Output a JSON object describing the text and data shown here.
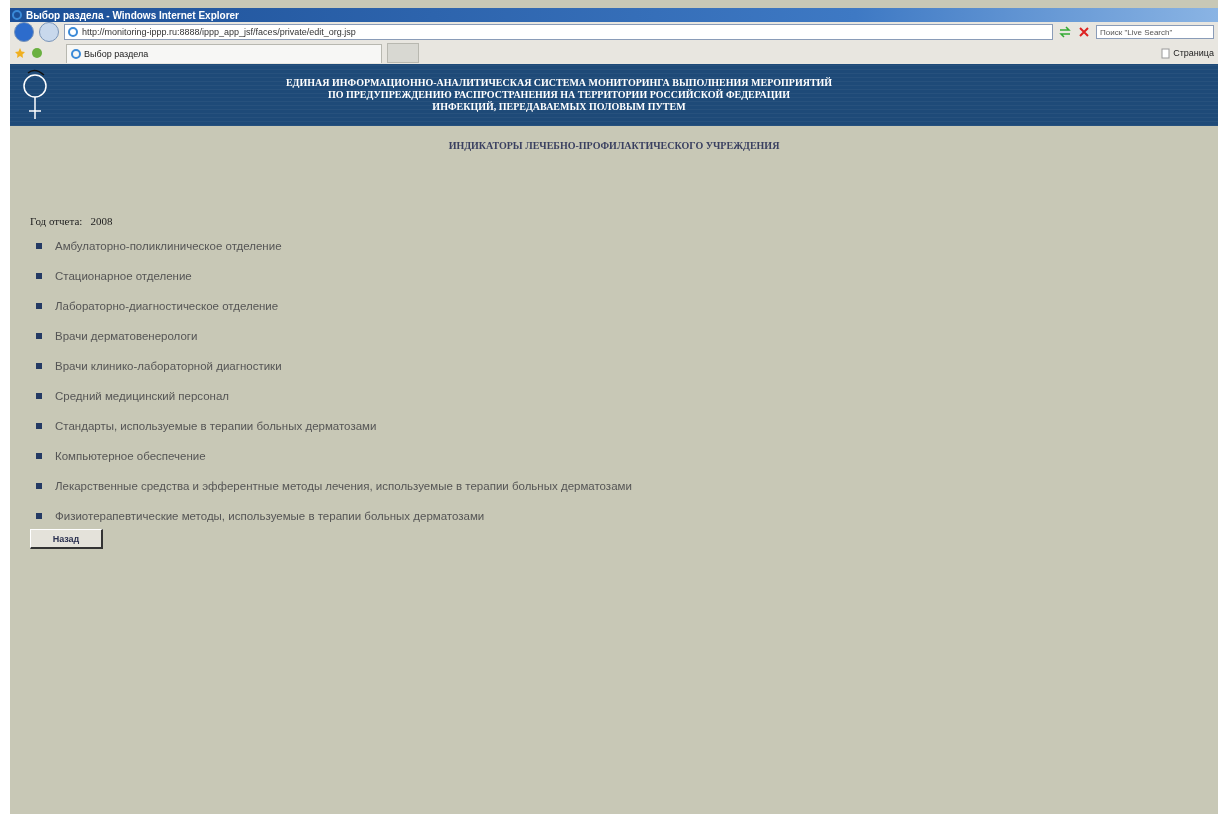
{
  "window": {
    "title": "Выбор раздела - Windows Internet Explorer"
  },
  "address_bar": {
    "url": "http://monitoring-ippp.ru:8888/ippp_app_jsf/faces/private/edit_org.jsp"
  },
  "search": {
    "placeholder": "Поиск \"Live Search\""
  },
  "tabs": [
    {
      "label": "Выбор раздела",
      "selected": true
    }
  ],
  "command_bar": {
    "page_label": "Страница"
  },
  "banner": {
    "lines": [
      "ЕДИНАЯ ИНФОРМАЦИОННО-АНАЛИТИЧЕСКАЯ СИСТЕМА МОНИТОРИНГА ВЫПОЛНЕНИЯ МЕРОПРИЯТИЙ",
      "ПО ПРЕДУПРЕЖДЕНИЮ РАСПРОСТРАНЕНИЯ НА ТЕРРИТОРИИ РОССИЙСКОЙ ФЕДЕРАЦИИ",
      "ИНФЕКЦИЙ, ПЕРЕДАВАЕМЫХ ПОЛОВЫМ ПУТЕМ"
    ]
  },
  "heading": "ИНДИКАТОРЫ ЛЕЧЕБНО-ПРОФИЛАКТИЧЕСКОГО УЧРЕЖДЕНИЯ",
  "report_year": {
    "label": "Год отчета:",
    "value": "2008"
  },
  "sections": [
    {
      "label": "Амбулаторно-поликлиническое отделение"
    },
    {
      "label": "Стационарное отделение"
    },
    {
      "label": "Лабораторно-диагностическое отделение"
    },
    {
      "label": "Врачи дерматовенерологи"
    },
    {
      "label": "Врачи клинико-лабораторной диагностики"
    },
    {
      "label": "Средний медицинский персонал"
    },
    {
      "label": "Стандарты, используемые в терапии больных дерматозами"
    },
    {
      "label": "Компьютерное обеспечение"
    },
    {
      "label": "Лекарственные средства и эфферентные методы лечения, используемые в терапии больных дерматозами"
    },
    {
      "label": "Физиотерапевтические методы, используемые в терапии больных дерматозами"
    }
  ],
  "buttons": [
    {
      "label": "Назад"
    }
  ]
}
